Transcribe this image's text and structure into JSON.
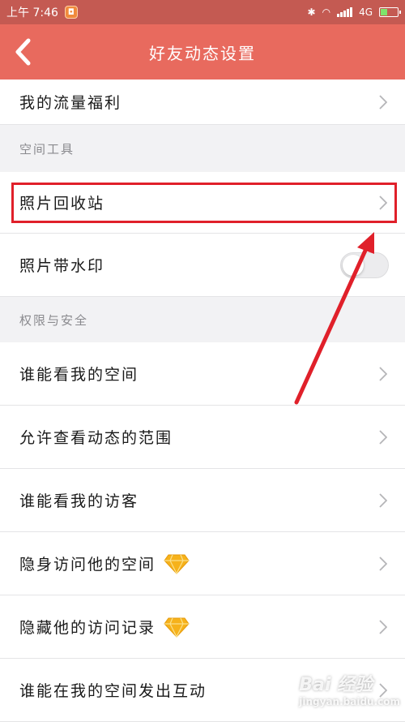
{
  "status_bar": {
    "time": "上午 7:46",
    "network": "4G",
    "app_badge_icon": "qzone-badge-icon"
  },
  "nav": {
    "title": "好友动态设置",
    "back_icon": "chevron-left-icon",
    "background": "#e86a5e"
  },
  "rows": {
    "traffic_welfare": "我的流量福利",
    "photo_recycle": "照片回收站",
    "photo_watermark": "照片带水印",
    "who_can_view": "谁能看我的空间",
    "allow_view_range": "允许查看动态的范围",
    "who_can_view_visitors": "谁能看我的访客",
    "invisible_visit": "隐身访问他的空间",
    "hide_visit_record": "隐藏他的访问记录",
    "who_can_interact": "谁能在我的空间发出互动"
  },
  "sections": {
    "space_tools": "空间工具",
    "permission_security": "权限与安全"
  },
  "toggles": {
    "photo_watermark_on": false
  },
  "annotation": {
    "highlight_color": "#e0202a",
    "highlighted_item": "照片回收站"
  },
  "watermark": {
    "text": "Bai 经验",
    "sub": "jingyan.baidu.com"
  }
}
